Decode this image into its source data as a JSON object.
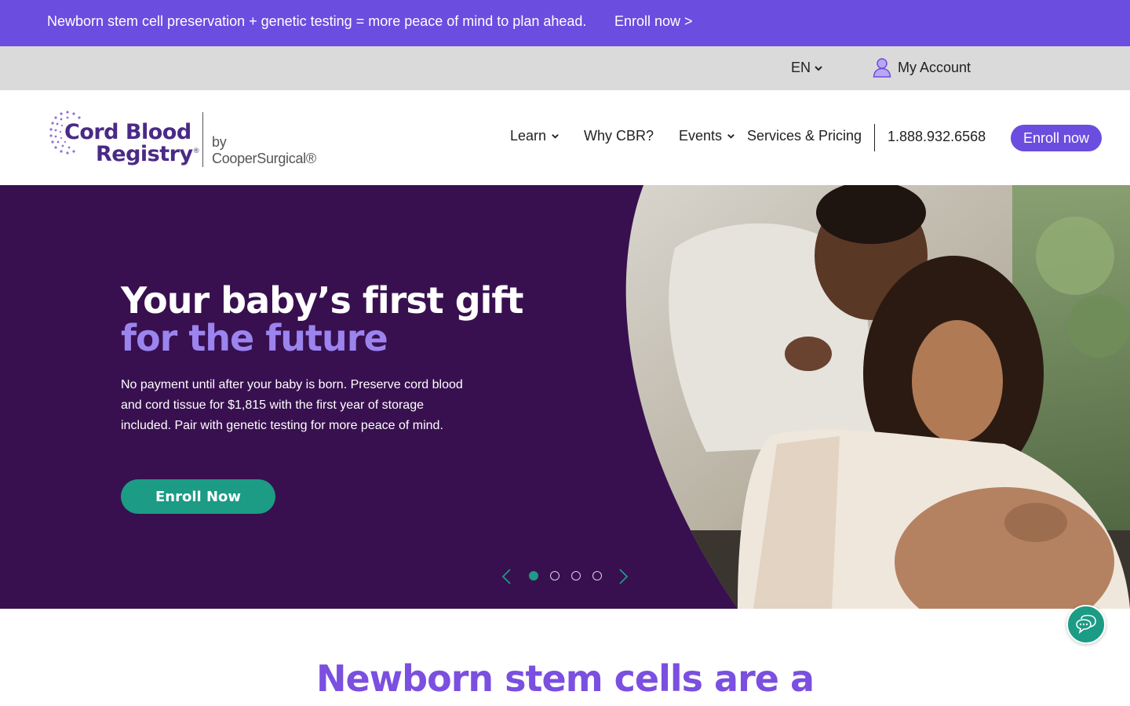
{
  "promo": {
    "text": "Newborn stem cell preservation + genetic testing = more peace of mind to plan ahead.",
    "link": "Enroll now >"
  },
  "utility": {
    "language": "EN",
    "account": "My Account"
  },
  "brand": {
    "line1": "Cord Blood",
    "line2": "Registry",
    "registered": "®",
    "byline": "by CooperSurgical®",
    "color": "#4a2a86"
  },
  "nav": {
    "learn": "Learn",
    "why": "Why CBR?",
    "events": "Events",
    "services": "Services & Pricing",
    "phone": "1.888.932.6568",
    "enroll": "Enroll now"
  },
  "hero": {
    "title_line1": "Your baby’s first gift",
    "title_line2": "for the future",
    "body": "No payment until after your baby is born. Preserve cord blood and cord tissue for $1,815 with the first year of storage included. Pair with genetic testing for more peace of mind.",
    "cta": "Enroll Now",
    "slides": 4,
    "active_slide": 1
  },
  "section": {
    "heading": "Newborn stem cells are a"
  },
  "colors": {
    "promo_bg": "#6b4ddf",
    "utility_bg": "#dadada",
    "hero_bg": "#38104f",
    "accent_purple": "#9b84ee",
    "teal": "#1c9b85",
    "heading_purple": "#7b4fe0"
  },
  "icons": {
    "language_chevron": "chevron-down-icon",
    "account": "user-icon",
    "carousel_prev": "chevron-left-icon",
    "carousel_next": "chevron-right-icon",
    "chat": "chat-bubbles-icon"
  }
}
